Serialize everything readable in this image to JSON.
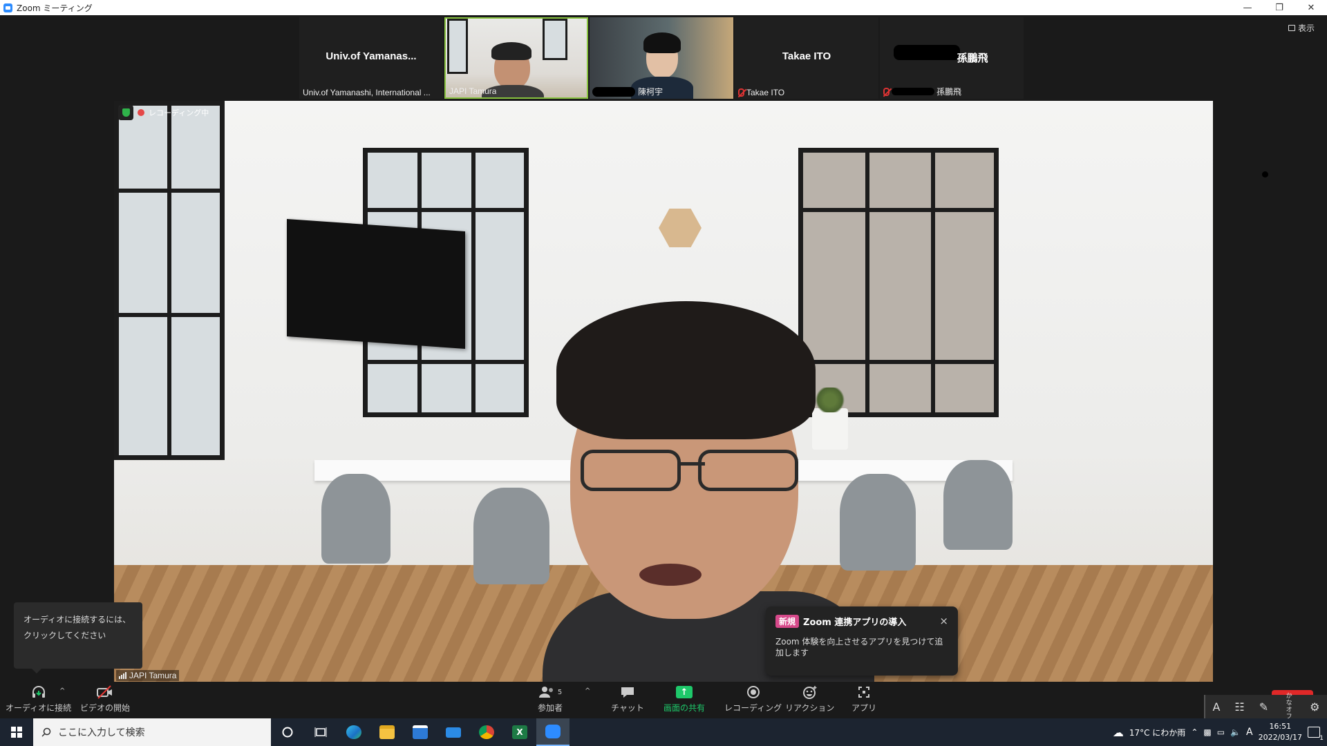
{
  "window": {
    "title": "Zoom ミーティング"
  },
  "header": {
    "view_label": "表示"
  },
  "participants_strip": [
    {
      "big_name": "Univ.of  Yamanas...",
      "caption": "Univ.of Yamanashi, International ...",
      "video": false,
      "muted": false
    },
    {
      "big_name": "",
      "caption": "JAPI Tamura",
      "video": true,
      "active_speaker": true
    },
    {
      "big_name": "",
      "caption": "陳柯宇",
      "video": true,
      "caption_redacted_prefix": true
    },
    {
      "big_name": "Takae ITO",
      "caption": "Takae ITO",
      "video": false,
      "muted": true
    },
    {
      "big_name": "孫鵬飛",
      "caption": "孫鵬飛",
      "video": false,
      "muted": true,
      "name_redacted_prefix": true
    }
  ],
  "main_video": {
    "recording_label": "レコーディング中",
    "speaker_name": "JAPI Tamura"
  },
  "audio_tooltip": {
    "text": "オーディオに接続するには、クリックしてください"
  },
  "notification": {
    "badge": "新規",
    "title": "Zoom 連携アプリの導入",
    "body": "Zoom 体験を向上させるアプリを見つけて追加します",
    "close": "×"
  },
  "toolbar": {
    "audio": "オーディオに接続",
    "video": "ビデオの開始",
    "participants": "参加者",
    "participants_count": "5",
    "chat": "チャット",
    "share": "画面の共有",
    "record": "レコーディング",
    "reactions": "リアクション",
    "apps": "アプリ",
    "accent": "#1ec86a"
  },
  "ime": [
    "A",
    "か な オ フ"
  ],
  "taskbar": {
    "search_placeholder": "ここに入力して検索",
    "weather": "17°C  にわか雨",
    "ime_indicator": "A",
    "time": "16:51",
    "date": "2022/03/17",
    "notification_count": "1"
  }
}
